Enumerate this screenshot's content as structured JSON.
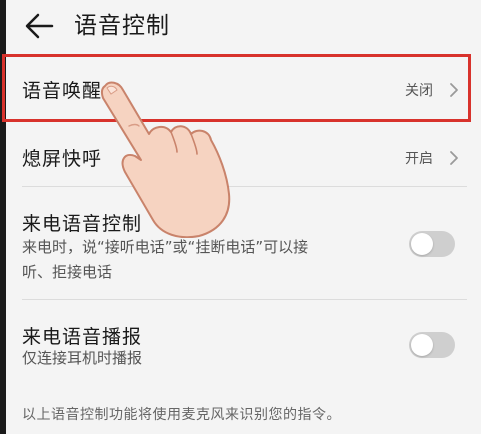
{
  "header": {
    "title": "语音控制",
    "back_icon": "arrow-left-icon"
  },
  "rows": [
    {
      "title": "语音唤醒",
      "value": "关闭",
      "type": "link"
    },
    {
      "title": "熄屏快呼",
      "value": "开启",
      "type": "link"
    },
    {
      "title": "来电语音控制",
      "subtitle_line1": "来电时，说“接听电话”或“挂断电话”可以接",
      "subtitle_line2": "听、拒接电话",
      "type": "toggle",
      "on": false
    },
    {
      "title": "来电语音播报",
      "subtitle_line1": "仅连接耳机时播报",
      "type": "toggle",
      "on": false
    }
  ],
  "footer": {
    "note": "以上语音控制功能将使用麦克风来识别您的指令。"
  },
  "colors": {
    "background": "#f4f4f4",
    "highlight": "#d8322c",
    "toggle_off": "#cfcfcf"
  },
  "overlay": {
    "pointer": "tapping-hand-icon"
  }
}
